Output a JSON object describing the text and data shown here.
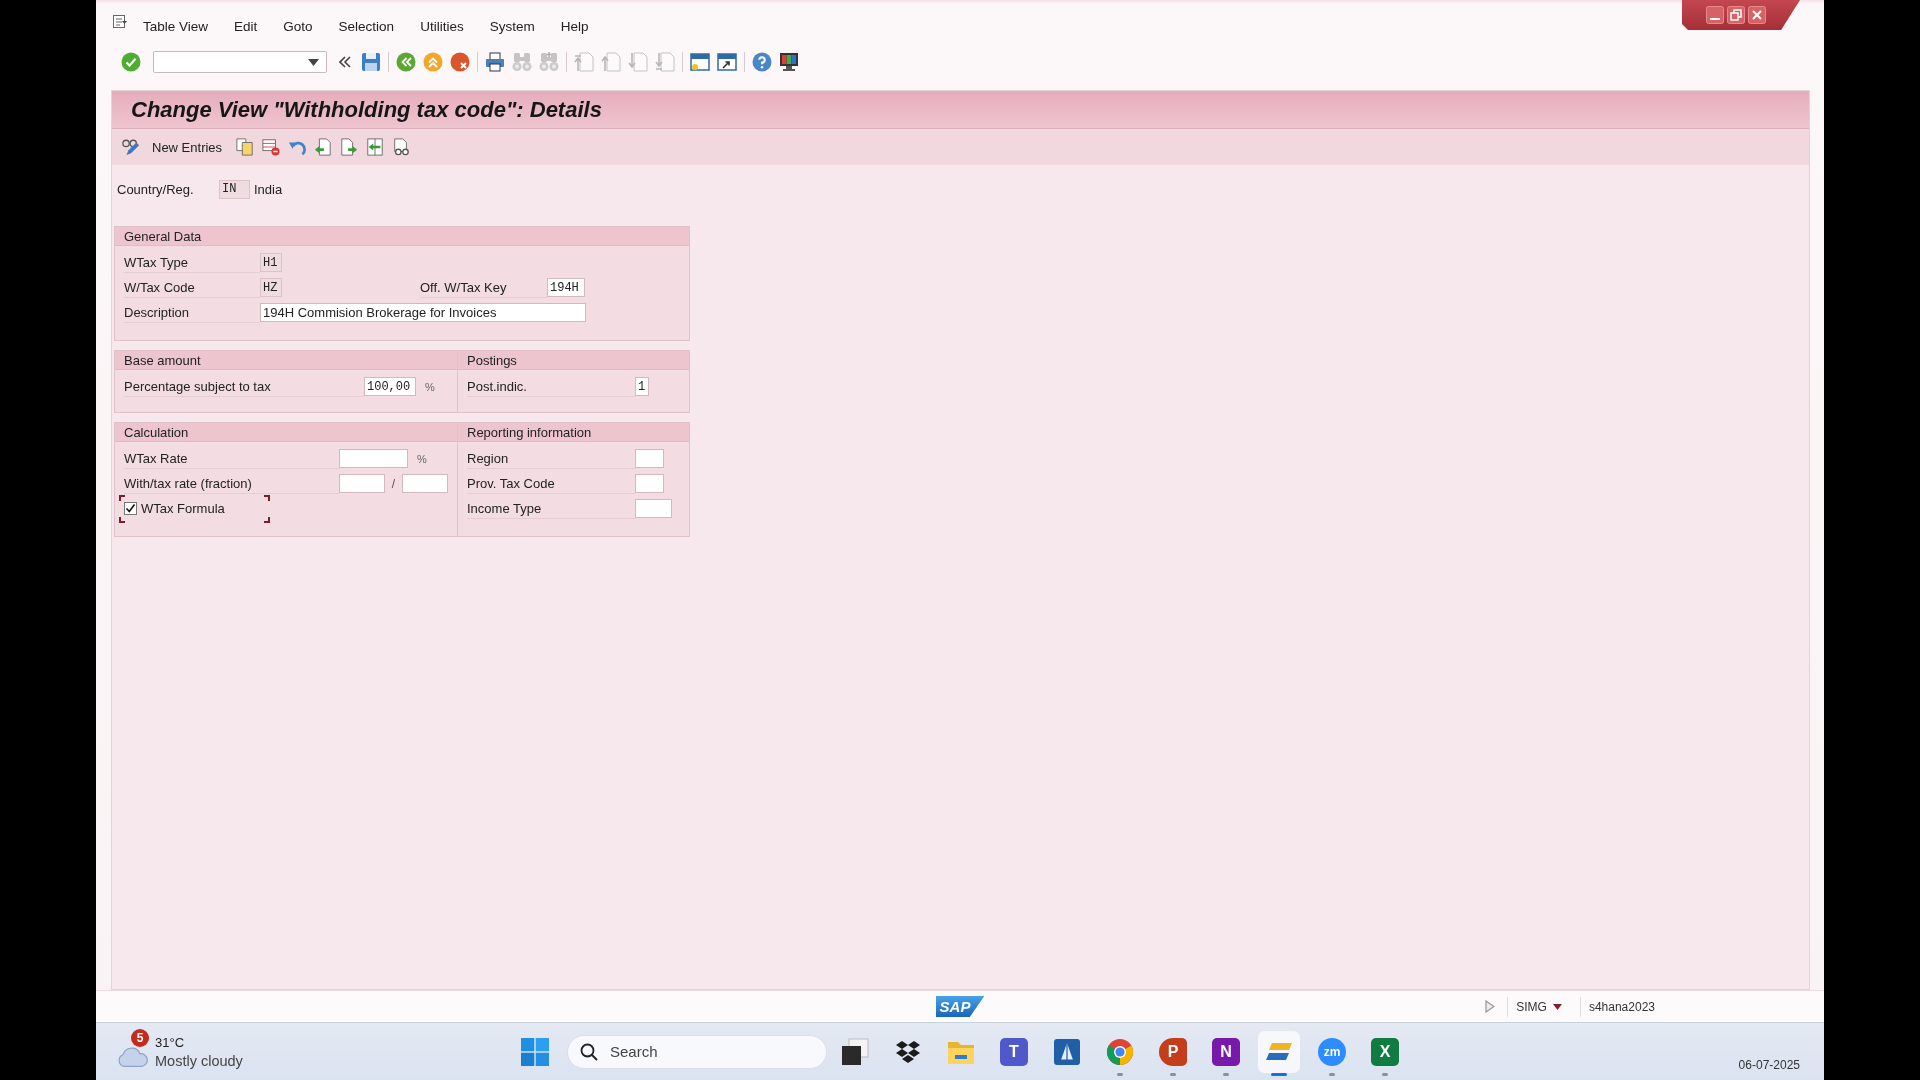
{
  "menu_bar": {
    "items": [
      "Table View",
      "Edit",
      "Goto",
      "Selection",
      "Utilities",
      "System",
      "Help"
    ]
  },
  "system_toolbar": {
    "groups": [
      [
        {
          "kind": "enter",
          "disabled": false
        }
      ],
      [
        {
          "kind": "save",
          "disabled": false
        }
      ],
      [
        {
          "kind": "back",
          "disabled": false
        },
        {
          "kind": "exit",
          "disabled": false
        },
        {
          "kind": "cancel",
          "disabled": false
        }
      ],
      [
        {
          "kind": "print",
          "disabled": false
        },
        {
          "kind": "find",
          "disabled": true
        },
        {
          "kind": "find_next",
          "disabled": true
        }
      ],
      [
        {
          "kind": "first_page",
          "disabled": true
        },
        {
          "kind": "previous_page",
          "disabled": true
        },
        {
          "kind": "next_page",
          "disabled": true
        },
        {
          "kind": "last_page",
          "disabled": true
        }
      ],
      [
        {
          "kind": "new_session",
          "disabled": false
        },
        {
          "kind": "shortcut",
          "disabled": false
        }
      ],
      [
        {
          "kind": "help",
          "disabled": false
        },
        {
          "kind": "layout",
          "disabled": false
        }
      ]
    ]
  },
  "screen": {
    "title": "Change View \"Withholding tax code\": Details"
  },
  "application_toolbar": {
    "items": [
      {
        "kind": "display_change"
      },
      {
        "kind": "new_entries",
        "label": "New Entries"
      },
      {
        "kind": "copy_as"
      },
      {
        "kind": "delete"
      },
      {
        "kind": "undo"
      },
      {
        "kind": "previous_entry"
      },
      {
        "kind": "next_entry"
      },
      {
        "kind": "other_entry"
      },
      {
        "kind": "print_view"
      }
    ]
  },
  "country": {
    "label": "Country/Reg.",
    "code": "IN",
    "name": "India"
  },
  "group_rows": [
    [
      {
        "title": "General Data",
        "rows": [
          {
            "kind": "field",
            "label": "WTax Type",
            "fields": [
              {
                "kind": "code",
                "value": "H1",
                "editable": false
              }
            ]
          },
          {
            "kind": "field",
            "label": "W/Tax Code",
            "fields": [
              {
                "kind": "code",
                "value": "HZ",
                "editable": false
              }
            ],
            "pair": {
              "label": "Off. W/Tax Key",
              "fields": [
                {
                  "kind": "key",
                  "value": "194H",
                  "editable": true
                }
              ]
            }
          },
          {
            "kind": "field",
            "label": "Description",
            "fields": [
              {
                "kind": "text",
                "value": "194H Commision Brokerage for Invoices",
                "editable": true
              }
            ]
          }
        ]
      }
    ],
    [
      {
        "title": "Base amount",
        "rows": [
          {
            "kind": "field",
            "label": "Percentage subject to tax",
            "fields": [
              {
                "kind": "amount",
                "value": "100,00",
                "editable": true
              }
            ],
            "unit": "%"
          }
        ]
      },
      {
        "title": "Postings",
        "rows": [
          {
            "kind": "field",
            "label": "Post.indic.",
            "fields": [
              {
                "kind": "flag",
                "value": "1",
                "editable": true
              }
            ]
          }
        ]
      }
    ],
    [
      {
        "title": "Calculation",
        "rows": [
          {
            "kind": "field",
            "label": "WTax Rate",
            "fields": [
              {
                "kind": "rate",
                "editable": true
              }
            ],
            "unit": "%"
          },
          {
            "kind": "field",
            "label": "With/tax rate (fraction)",
            "fields": [
              {
                "kind": "fraction",
                "editable": true
              },
              {
                "kind": "fraction",
                "editable": true
              }
            ],
            "separator": "/"
          },
          {
            "kind": "checkbox",
            "label": "WTax Formula",
            "checked": true,
            "focused": true
          }
        ]
      },
      {
        "title": "Reporting information",
        "rows": [
          {
            "kind": "field",
            "label": "Region",
            "fields": [
              {
                "kind": "short",
                "editable": true
              }
            ]
          },
          {
            "kind": "field",
            "label": "Prov. Tax Code",
            "fields": [
              {
                "kind": "short",
                "editable": true
              }
            ]
          },
          {
            "kind": "field",
            "label": "Income Type",
            "fields": [
              {
                "kind": "medium",
                "editable": true
              }
            ]
          }
        ]
      }
    ]
  ],
  "status_bar": {
    "logo": "SAP",
    "system": "SIMG",
    "client": "s4hana2023"
  },
  "taskbar": {
    "weather": {
      "badge": "5",
      "temperature": "31°C",
      "condition": "Mostly cloudy"
    },
    "search": {
      "placeholder": "Search"
    },
    "apps": [
      {
        "kind": "task_view",
        "running": false,
        "selected": false
      },
      {
        "kind": "dropbox",
        "running": false,
        "selected": false
      },
      {
        "kind": "file_explorer",
        "running": false,
        "selected": false
      },
      {
        "kind": "teams",
        "glyph": "T",
        "running": false,
        "selected": false
      },
      {
        "kind": "app",
        "running": false,
        "selected": false
      },
      {
        "kind": "chrome",
        "running": true,
        "selected": false
      },
      {
        "kind": "powerpoint",
        "glyph": "P",
        "running": true,
        "selected": false
      },
      {
        "kind": "onenote",
        "glyph": "N",
        "running": true,
        "selected": false
      },
      {
        "kind": "sap_gui",
        "running": true,
        "selected": true
      },
      {
        "kind": "zoom",
        "glyph": "zm",
        "running": true,
        "selected": false
      },
      {
        "kind": "excel",
        "glyph": "X",
        "running": true,
        "selected": false
      }
    ],
    "date": "06-07-2025"
  }
}
